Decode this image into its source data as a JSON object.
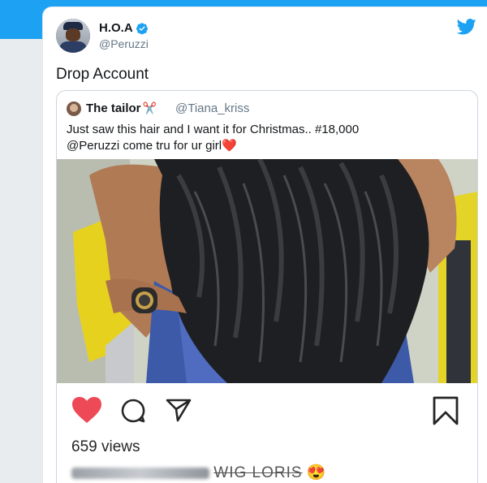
{
  "colors": {
    "twitter_blue": "#1da1f2",
    "like_red": "#ed4956"
  },
  "tweet": {
    "author_name": "H.O.A",
    "author_handle": "@Peruzzi",
    "text": "Drop Account",
    "icons": {
      "avatar": "avatar",
      "verified": "verified-badge-icon",
      "brand": "twitter-bird-icon"
    }
  },
  "quote": {
    "author_name": "The tailor",
    "author_name_emoji": "✂️",
    "author_handle": "@Tiana_kriss",
    "text_line1": "Just saw this hair and I want it for Christmas.. #18,000",
    "text_line2": "@Peruzzi come tru for ur girl",
    "text_emoji": "❤️"
  },
  "instagram": {
    "views": "659 views",
    "caption_visible": "WIG LORIS",
    "caption_emoji": "😍",
    "icons": [
      "heart-icon",
      "comment-icon",
      "share-icon",
      "bookmark-icon"
    ]
  }
}
